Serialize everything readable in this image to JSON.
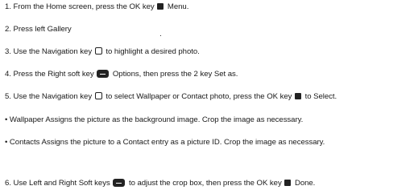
{
  "steps": [
    {
      "parts": [
        "1. From the Home screen, press the OK key",
        "Menu."
      ],
      "icons": [
        "ok-key-icon"
      ]
    },
    {
      "parts": [
        "2. Press left Gallery"
      ],
      "icons": []
    },
    {
      "parts": [
        "3. Use the Navigation key",
        "to highlight a desired photo."
      ],
      "icons": [
        "navigation-key-icon"
      ]
    },
    {
      "parts": [
        "4. Press the Right soft key",
        "Options, then press the 2 key Set as."
      ],
      "icons": [
        "soft-key-icon"
      ]
    },
    {
      "parts": [
        "5. Use the Navigation key",
        "to select Wallpaper or Contact photo, press the OK key",
        "to Select."
      ],
      "icons": [
        "navigation-key-icon",
        "ok-key-icon"
      ]
    },
    {
      "parts": [
        "• Wallpaper Assigns the picture as the background image. Crop the image as necessary."
      ],
      "icons": []
    },
    {
      "parts": [
        "• Contacts Assigns the picture to a Contact entry as a picture ID. Crop the image as necessary."
      ],
      "icons": []
    },
    {
      "parts": [
        "6. Use Left and Right Soft keys",
        "to adjust the crop box, then press the OK key",
        "Done."
      ],
      "icons": [
        "soft-key-icon",
        "ok-key-icon"
      ]
    }
  ]
}
